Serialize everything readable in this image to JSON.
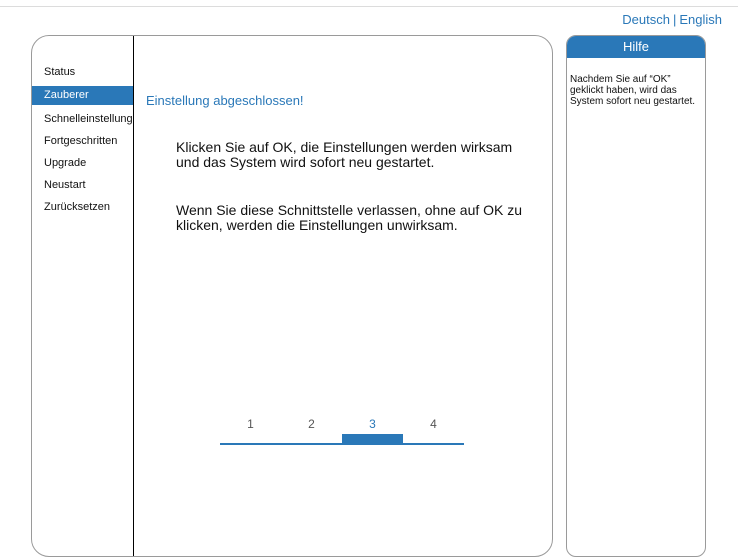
{
  "language": {
    "de": "Deutsch",
    "en": "English"
  },
  "sidebar": {
    "items": [
      {
        "label": "Status"
      },
      {
        "label": "Zauberer"
      },
      {
        "label": "Schnelleinstellung"
      },
      {
        "label": "Fortgeschritten"
      },
      {
        "label": "Upgrade"
      },
      {
        "label": "Neustart"
      },
      {
        "label": "Zurücksetzen"
      }
    ],
    "active_index": 1
  },
  "main": {
    "title": "Einstellung abgeschlossen!",
    "paragraph1": "Klicken Sie auf OK, die Einstellungen werden wirksam und das System wird sofort neu gestartet.",
    "paragraph2": "Wenn Sie diese Schnittstelle verlassen, ohne auf OK zu klicken, werden die Einstellungen unwirksam."
  },
  "steps": {
    "labels": [
      "1",
      "2",
      "3",
      "4"
    ],
    "current": 3
  },
  "help": {
    "title": "Hilfe",
    "text": "Nachdem Sie auf “OK” geklickt haben, wird das System sofort neu gestartet."
  },
  "colors": {
    "accent": "#2a78b8"
  }
}
